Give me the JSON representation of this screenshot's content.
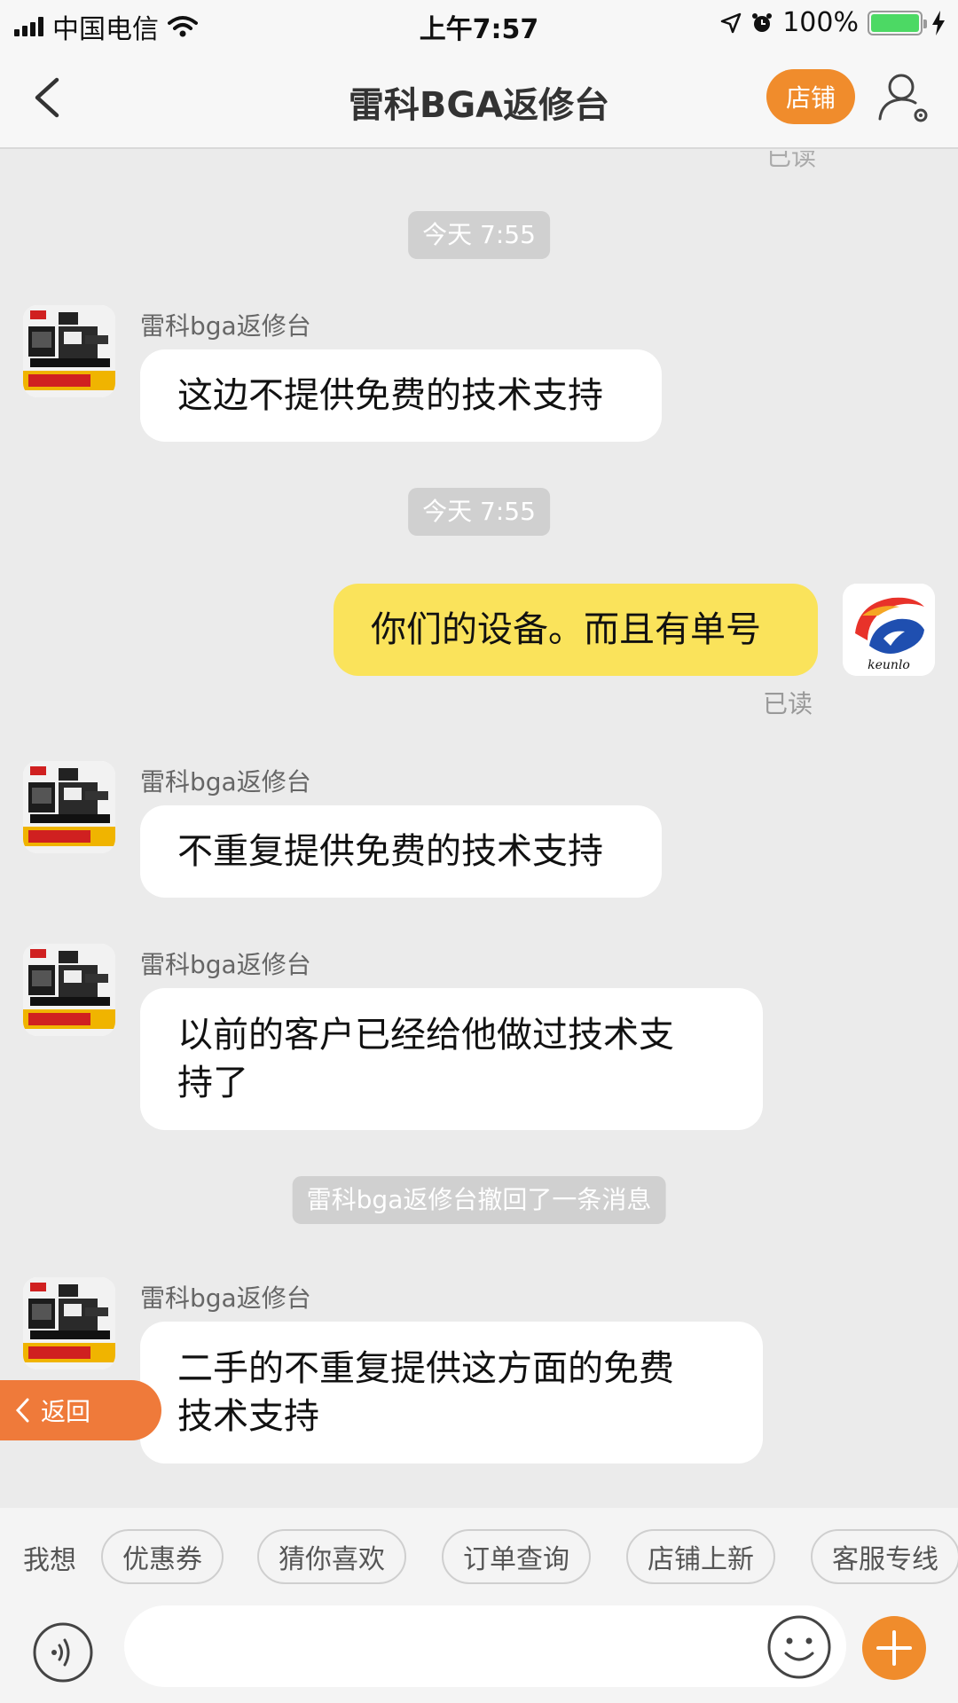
{
  "status_bar": {
    "carrier": "中国电信",
    "time": "上午7:57",
    "battery": "100%"
  },
  "nav": {
    "title": "雷科BGA返修台",
    "store_label": "店铺"
  },
  "chat": {
    "top_read_label": "已读",
    "messages": [
      {
        "type": "time",
        "text": "今天 7:55"
      },
      {
        "type": "received",
        "sender": "雷科bga返修台",
        "text": "这边不提供免费的技术支持"
      },
      {
        "type": "time",
        "text": "今天 7:55"
      },
      {
        "type": "sent",
        "text": "你们的设备。而且有单号",
        "status": "已读"
      },
      {
        "type": "received",
        "sender": "雷科bga返修台",
        "text": "不重复提供免费的技术支持"
      },
      {
        "type": "received",
        "sender": "雷科bga返修台",
        "text_lines": [
          "以前的客户已经给他做过技术支",
          "持了"
        ]
      },
      {
        "type": "system",
        "text": "雷科bga返修台撤回了一条消息"
      },
      {
        "type": "received",
        "sender": "雷科bga返修台",
        "text_lines": [
          "二手的不重复提供这方面的免费",
          "技术支持"
        ]
      }
    ]
  },
  "floating_back": {
    "label": "返回"
  },
  "quick_bar": {
    "label": "我想",
    "chips": [
      "优惠券",
      "猜你喜欢",
      "订单查询",
      "店铺上新",
      "客服专线"
    ]
  },
  "input_bar": {
    "placeholder": ""
  },
  "colors": {
    "accent_orange": "#f08c2c",
    "sent_bubble": "#fae35b",
    "battery_green": "#4cd964",
    "chat_background": "#ebebeb"
  },
  "icons": {
    "back": "chevron-left-icon",
    "profile": "user-settings-icon",
    "voice": "voice-icon",
    "emoji": "smiley-icon",
    "plus": "plus-icon"
  }
}
